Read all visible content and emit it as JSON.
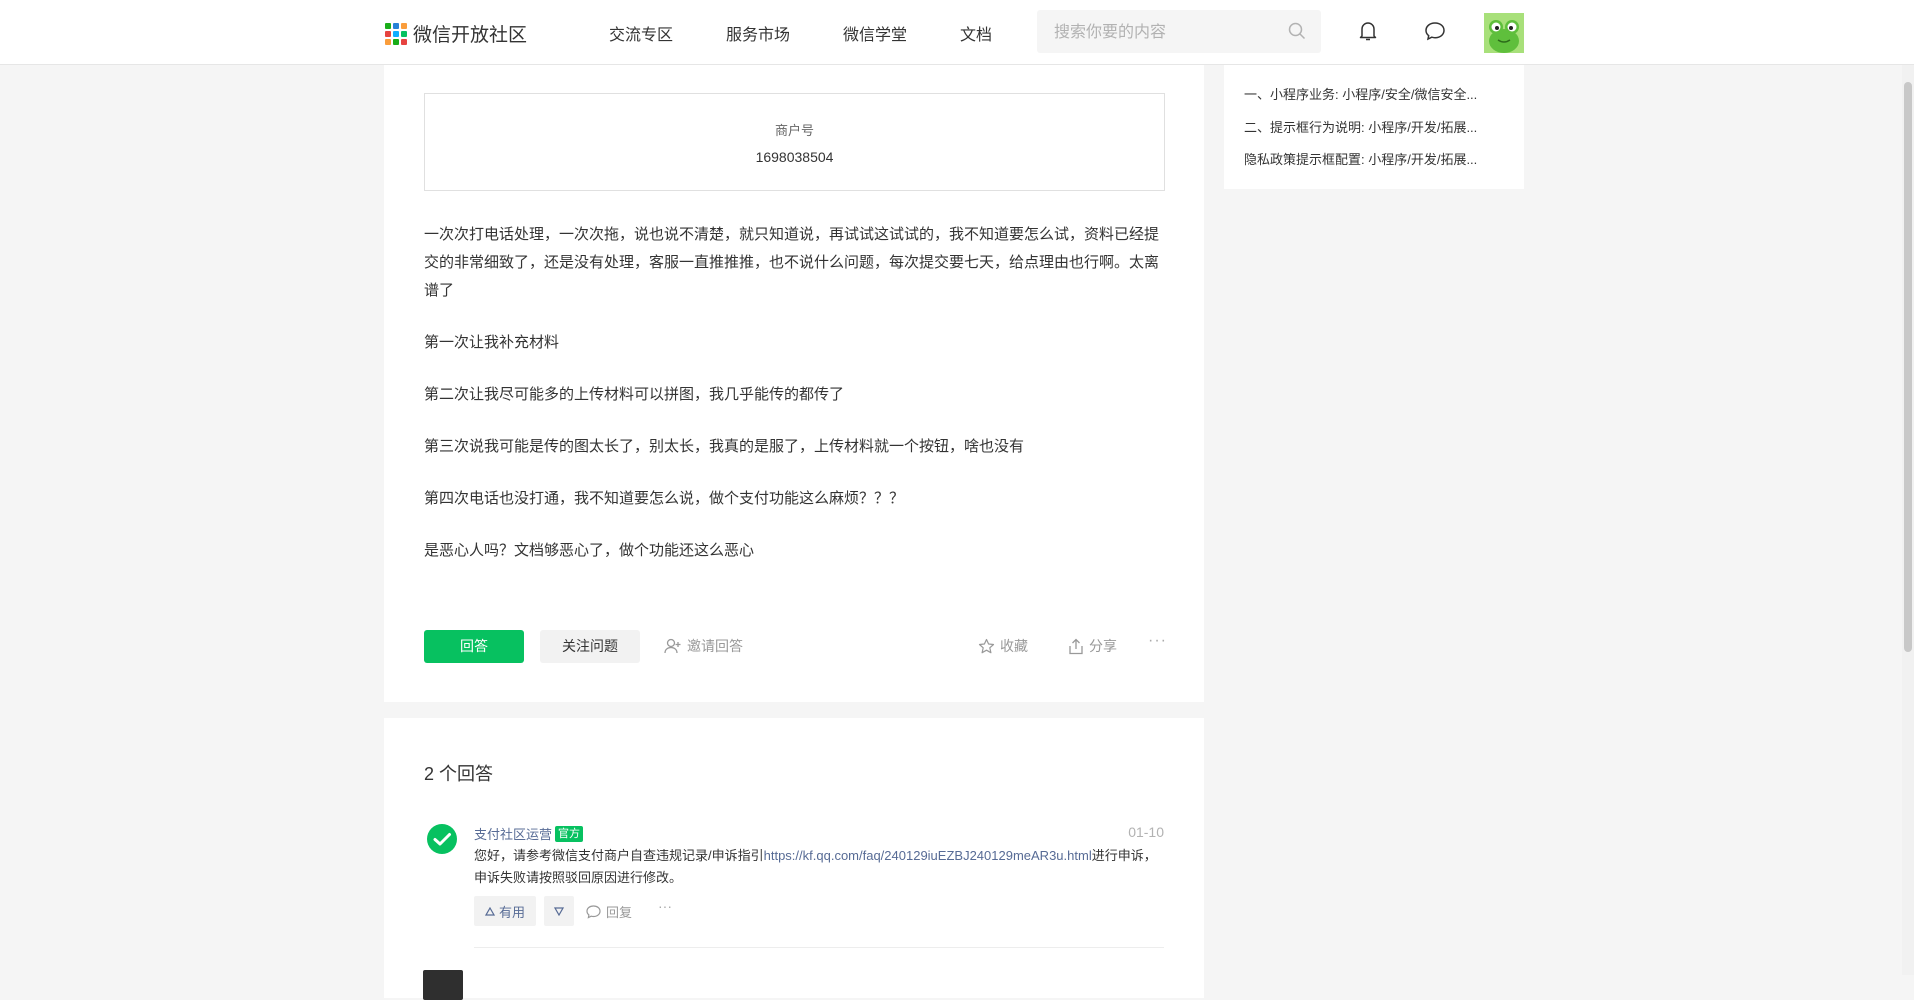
{
  "header": {
    "logo_text": "微信开放社区",
    "nav": [
      {
        "label": "交流专区"
      },
      {
        "label": "服务市场"
      },
      {
        "label": "微信学堂"
      },
      {
        "label": "文档"
      }
    ],
    "search_placeholder": "搜索你要的内容",
    "icons": [
      "bell-icon",
      "message-icon",
      "search-icon"
    ],
    "colors": {
      "accent": "#07c160",
      "link": "#576b95"
    }
  },
  "question": {
    "merchant_label": "商户号",
    "merchant_value": "1698038504",
    "paragraphs": [
      "一次次打电话处理，一次次拖，说也说不清楚，就只知道说，再试试这试试的，我不知道要怎么试，资料已经提交的非常细致了，还是没有处理，客服一直推推推，也不说什么问题，每次提交要七天，给点理由也行啊。太离谱了",
      "第一次让我补充材料",
      "第二次让我尽可能多的上传材料可以拼图，我几乎能传的都传了",
      "第三次说我可能是传的图太长了，别太长，我真的是服了，上传材料就一个按钮，啥也没有",
      "第四次电话也没打通，我不知道要怎么说，做个支付功能这么麻烦？？？",
      "是恶心人吗？文档够恶心了，做个功能还这么恶心"
    ],
    "actions": {
      "answer": "回答",
      "follow": "关注问题",
      "invite": "邀请回答",
      "collect": "收藏",
      "share": "分享",
      "more": "···"
    }
  },
  "answers": {
    "count_label": "2 个回答",
    "items": [
      {
        "author": "支付社区运营",
        "badge": "官方",
        "date": "01-10",
        "text_before": "您好，请参考微信支付商户自查违规记录/申诉指引",
        "link": "https://kf.qq.com/faq/240129iuEZBJ240129meAR3u.html",
        "text_after": "进行申诉， 申诉失败请按照驳回原因进行修改。",
        "useful_label": "有用",
        "reply_label": "回复",
        "more": "···"
      }
    ]
  },
  "sidebar": {
    "items": [
      {
        "label": "一、小程序业务: 小程序/安全/微信安全..."
      },
      {
        "label": "二、提示框行为说明: 小程序/开发/拓展..."
      },
      {
        "label": "隐私政策提示框配置: 小程序/开发/拓展..."
      }
    ]
  }
}
